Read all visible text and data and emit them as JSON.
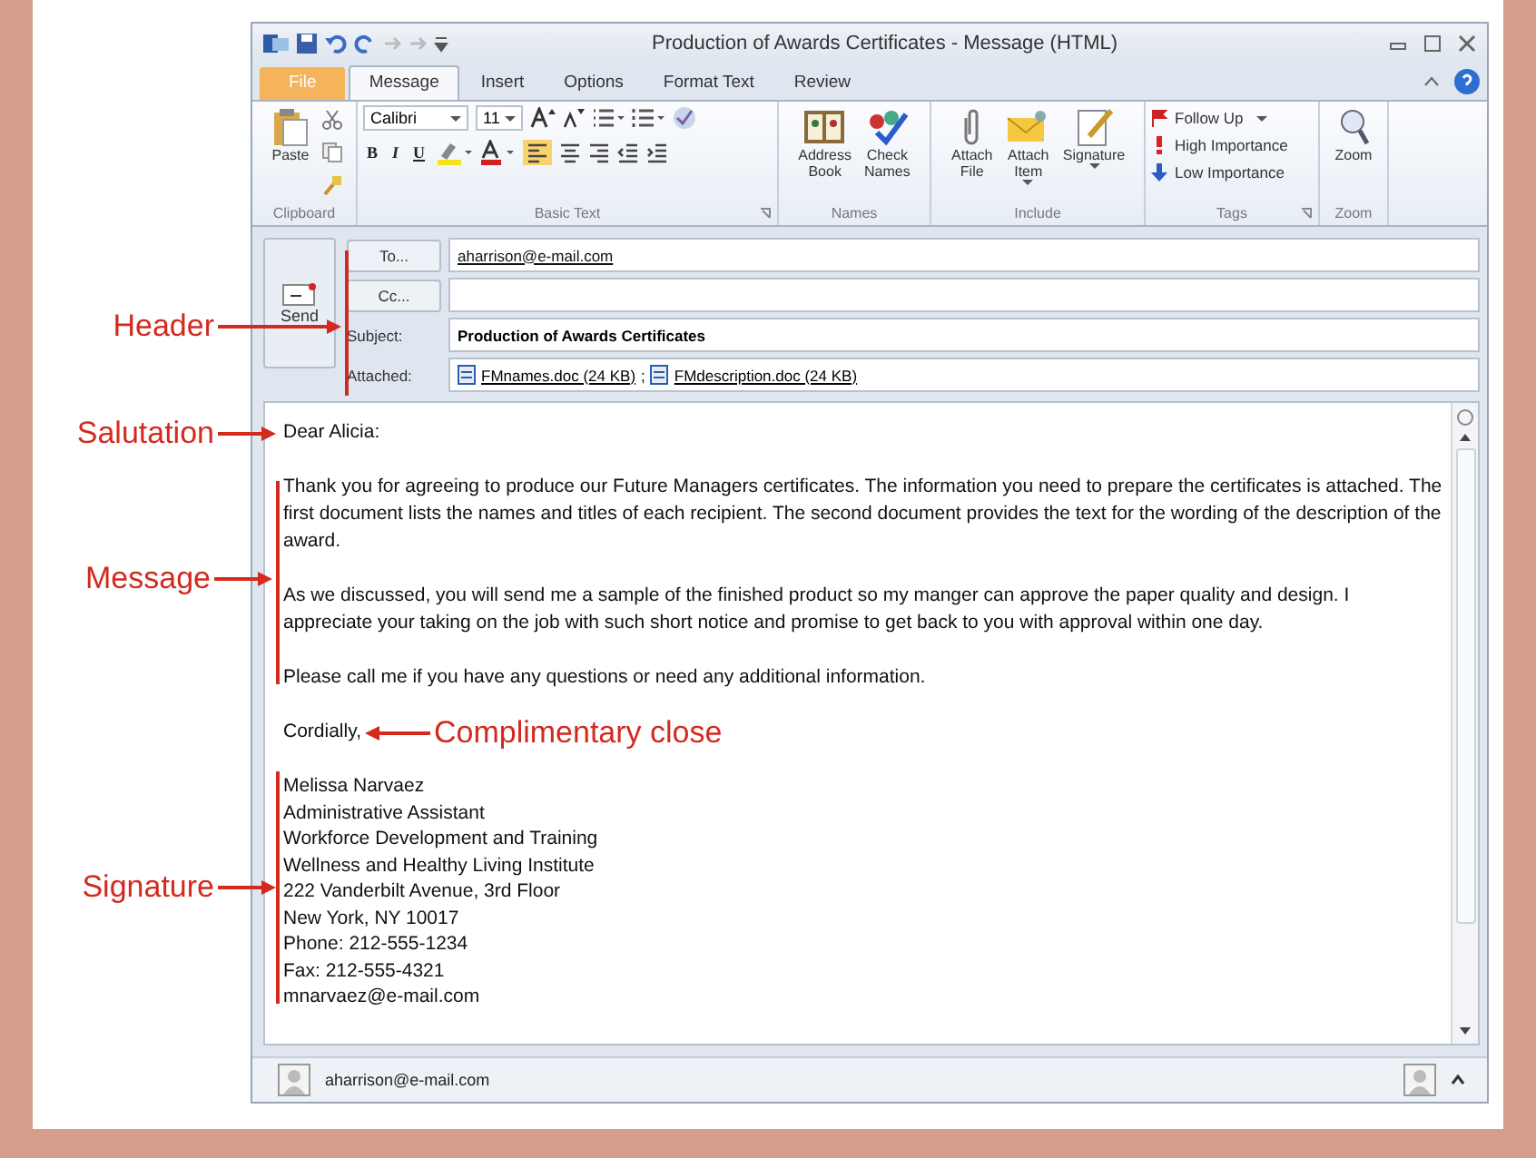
{
  "window": {
    "title": "Production of Awards Certificates - Message (HTML)"
  },
  "tabs": [
    {
      "label": "File",
      "kind": "file",
      "selected": false
    },
    {
      "label": "Message",
      "kind": "tab",
      "selected": true
    },
    {
      "label": "Insert",
      "kind": "tab",
      "selected": false
    },
    {
      "label": "Options",
      "kind": "tab",
      "selected": false
    },
    {
      "label": "Format Text",
      "kind": "tab",
      "selected": false
    },
    {
      "label": "Review",
      "kind": "tab",
      "selected": false
    }
  ],
  "ribbon": {
    "clipboard": {
      "label": "Clipboard",
      "paste": "Paste"
    },
    "basic_text": {
      "label": "Basic Text",
      "font": "Calibri",
      "size": "11",
      "format_buttons": [
        "B",
        "I",
        "U"
      ]
    },
    "names": {
      "label": "Names",
      "commands": [
        "Address Book",
        "Check Names"
      ]
    },
    "include": {
      "label": "Include",
      "commands": [
        "Attach File",
        "Attach Item",
        "Signature"
      ]
    },
    "tags": {
      "label": "Tags",
      "commands": [
        "Follow Up",
        "High Importance",
        "Low Importance"
      ]
    },
    "zoom": {
      "label": "Zoom",
      "command": "Zoom"
    }
  },
  "header": {
    "send": "Send",
    "fields": [
      {
        "kind": "button",
        "label": "To...",
        "value": "aharrison@e-mail.com"
      },
      {
        "kind": "button",
        "label": "Cc..."
      },
      {
        "kind": "label",
        "label": "Subject:",
        "value": "Production of Awards Certificates"
      }
    ],
    "attached_label": "Attached:",
    "attachments": [
      "FMnames.doc (24 KB)",
      "FMdescription.doc (24 KB)"
    ],
    "attachment_separator": ";"
  },
  "body": {
    "salutation": "Dear Alicia:",
    "paragraphs": [
      "Thank you for agreeing to produce our Future Managers certificates. The information you need to prepare the certificates is attached. The first document lists the names and titles of each recipient. The second document provides the text for the wording of the description of the award.",
      "As we discussed, you will send me a sample of the finished product so my manger can approve the paper quality and design. I appreciate your taking on the job with such short notice and promise to get back to you with approval within one day.",
      "Please call me if you have any questions or need any additional information."
    ],
    "close": "Cordially,",
    "signature": [
      "Melissa Narvaez",
      "Administrative Assistant",
      "Workforce Development and Training",
      "Wellness and Healthy Living Institute",
      "222 Vanderbilt Avenue, 3rd Floor",
      "New York, NY 10017",
      "Phone: 212-555-1234",
      "Fax: 212-555-4321",
      "mnarvaez@e-mail.com"
    ]
  },
  "people_pane": {
    "contact": "aharrison@e-mail.com"
  },
  "callouts": [
    {
      "label": "Header"
    },
    {
      "label": "Salutation"
    },
    {
      "label": "Message"
    },
    {
      "label": "Complimentary close"
    },
    {
      "label": "Signature"
    }
  ]
}
